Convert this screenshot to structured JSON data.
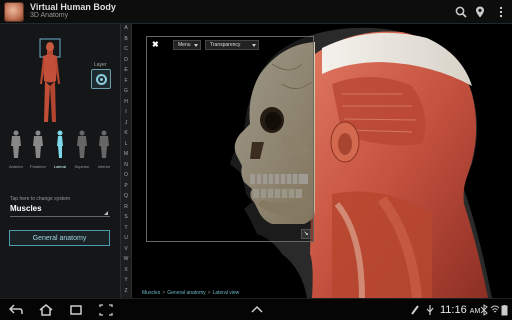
{
  "app": {
    "title": "Virtual Human Body",
    "subtitle": "3D Anatomy"
  },
  "actionbar": {
    "icons": [
      "search-icon",
      "location-pin-icon",
      "overflow-menu-icon"
    ]
  },
  "left_panel": {
    "layer_label": "Layer",
    "views": [
      {
        "label": "Anterior",
        "active": false
      },
      {
        "label": "Posterior",
        "active": false
      },
      {
        "label": "Lateral",
        "active": true
      },
      {
        "label": "Superior",
        "active": false
      },
      {
        "label": "Inferior",
        "active": false
      }
    ],
    "system_hint": "Tap here to change system",
    "system_value": "Muscles",
    "anatomy_button": "General anatomy"
  },
  "alphabet": [
    "A",
    "B",
    "C",
    "D",
    "E",
    "F",
    "G",
    "H",
    "I",
    "J",
    "K",
    "L",
    "M",
    "N",
    "O",
    "P",
    "Q",
    "R",
    "S",
    "T",
    "U",
    "V",
    "W",
    "X",
    "Y",
    "Z"
  ],
  "overlay": {
    "close": "✖",
    "menu_label": "Menu",
    "transparency_label": "Transparency",
    "corner_icon": "expand-icon"
  },
  "breadcrumb": [
    "Muscles",
    "General anatomy",
    "Lateral view"
  ],
  "status_bar": {
    "time": "11:16",
    "am_pm": "AM"
  },
  "colors": {
    "accent": "#4a9dae",
    "muscle": "#c5513f",
    "bone": "#e8dcc2"
  }
}
